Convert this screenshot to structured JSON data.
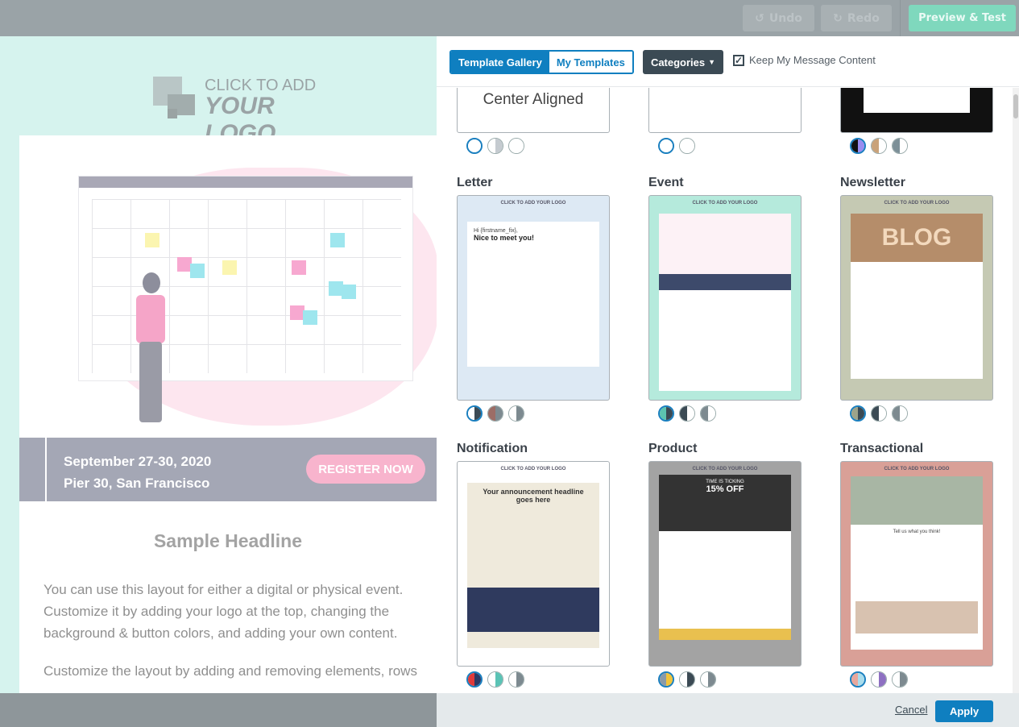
{
  "toolbar": {
    "undo": "Undo",
    "redo": "Redo",
    "preview": "Preview & Test"
  },
  "editor": {
    "logo_line1": "CLICK TO ADD",
    "logo_line2": "YOUR LOGO",
    "date": "September 27-30, 2020",
    "location": "Pier 30, San Francisco",
    "register": "REGISTER NOW",
    "headline": "Sample Headline",
    "para1": [
      "You can use this layout for either a digital or physical event.",
      "Customize it by adding your logo at the top, changing the",
      "background & button colors, and adding your own content."
    ],
    "para2": "Customize the layout by adding and removing elements, rows"
  },
  "gallery": {
    "tab_gallery": "Template Gallery",
    "tab_my": "My Templates",
    "categories": "Categories",
    "keep_content": "Keep My Message Content",
    "keep_checked": true,
    "row0": [
      {
        "preview_text": "Center Aligned",
        "swatches": [
          [
            "#ffffff",
            "#ffffff"
          ],
          [
            "#ffffff",
            "#c5cbd0"
          ],
          [
            "#ffffff",
            "#ffffff"
          ]
        ]
      },
      {
        "preview_text": "",
        "swatches": [
          [
            "#ffffff",
            "#ffffff"
          ],
          [
            "#ffffff",
            "#ffffff"
          ]
        ]
      },
      {
        "preview_text": "",
        "swatches": [
          [
            "#111111",
            "#9a8cf0"
          ],
          [
            "#c9a27a",
            "#ffffff"
          ],
          [
            "#7d9098",
            "#ffffff"
          ]
        ]
      }
    ],
    "templates": [
      {
        "name": "Letter",
        "bg": "#dde9f4",
        "inner": "Nice to meet you!",
        "greeting": "Hi {firstname_fix},",
        "swatches": [
          [
            "#ffffff",
            "#3b4a54"
          ],
          [
            "#9c6d66",
            "#7d8a90"
          ],
          [
            "#ffffff",
            "#7d8a90"
          ]
        ]
      },
      {
        "name": "Event",
        "bg": "#b5eadc",
        "inner": "",
        "swatches": [
          [
            "#5cc4b0",
            "#3b4a54"
          ],
          [
            "#3b4a54",
            "#ffffff"
          ],
          [
            "#7d8a90",
            "#ffffff"
          ]
        ]
      },
      {
        "name": "Newsletter",
        "bg": "#c5c9b3",
        "inner": "BLOG",
        "swatches": [
          [
            "#9da38a",
            "#3b4a54"
          ],
          [
            "#3b4a54",
            "#ffffff"
          ],
          [
            "#7d8a90",
            "#ffffff"
          ]
        ]
      },
      {
        "name": "Notification",
        "bg": "#ffffff",
        "inner": "Your announcement headline goes here",
        "swatches": [
          [
            "#e03a3a",
            "#2c3a66"
          ],
          [
            "#ffffff",
            "#5ac3b5"
          ],
          [
            "#ffffff",
            "#7d8a90"
          ]
        ]
      },
      {
        "name": "Product",
        "bg": "#a3a3a3",
        "inner": "15% OFF",
        "kicker": "TIME IS TICKING",
        "swatches": [
          [
            "#8a9aa8",
            "#f0c43a"
          ],
          [
            "#ffffff",
            "#3b4a54"
          ],
          [
            "#ffffff",
            "#7d8a90"
          ]
        ]
      },
      {
        "name": "Transactional",
        "bg": "#d9a097",
        "inner": "Tell us what you think!",
        "swatches": [
          [
            "#e7a79c",
            "#a9dcec"
          ],
          [
            "#ffffff",
            "#8e70c2"
          ],
          [
            "#ffffff",
            "#7d8a90"
          ]
        ]
      }
    ],
    "logo_small": "CLICK TO ADD YOUR LOGO",
    "cancel": "Cancel",
    "apply": "Apply"
  },
  "colors": {
    "accent": "#0f7fc0",
    "preview_button": "#7fd8bd",
    "register_button": "#f8b4cd"
  }
}
